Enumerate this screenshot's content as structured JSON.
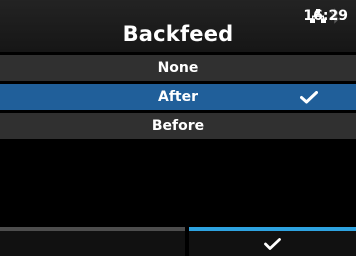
{
  "header": {
    "title": "Backfeed",
    "time": "16:29",
    "icons": [
      "network-icon",
      "bluetooth-icon"
    ]
  },
  "options": [
    {
      "label": "None",
      "selected": false
    },
    {
      "label": "After",
      "selected": true
    },
    {
      "label": "Before",
      "selected": false
    }
  ],
  "softkeys": {
    "left": {
      "label": ""
    },
    "right": {
      "icon": "check-icon"
    }
  },
  "colors": {
    "selection": "#205f9a",
    "softkey_accent": "#2ea3e0",
    "row": "#303030"
  }
}
